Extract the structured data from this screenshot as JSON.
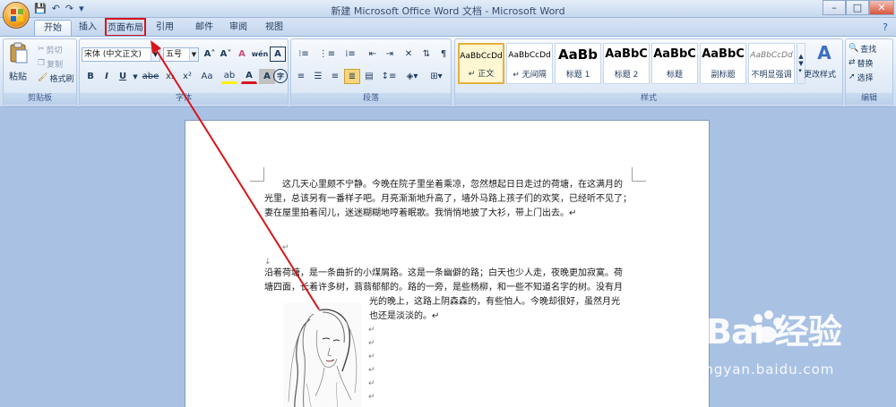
{
  "window": {
    "title": "新建 Microsoft Office Word 文档 - Microsoft Word",
    "controls": {
      "minimize": "–",
      "maximize": "□",
      "close": "✕"
    }
  },
  "qat": {
    "save": "💾",
    "undo": "↶",
    "redo": "↷",
    "more": "▾"
  },
  "tabs": [
    "开始",
    "插入",
    "页面布局",
    "引用",
    "邮件",
    "审阅",
    "视图"
  ],
  "highlighted_tab": "页面布局",
  "ribbon": {
    "clipboard": {
      "label": "剪贴板",
      "paste": "粘贴",
      "cut": "剪切",
      "copy": "复制",
      "format_painter": "格式刷"
    },
    "font": {
      "label": "字体",
      "font_name": "宋体 (中文正文)",
      "font_size": "五号",
      "bold": "B",
      "italic": "I",
      "underline": "U",
      "strike": "abe",
      "sub": "x₂",
      "sup": "x²",
      "case": "Aa",
      "grow": "A˄",
      "shrink": "A˅",
      "clear": "A",
      "phonetic": "wén",
      "border_char": "A",
      "highlight": "ab",
      "font_color": "A",
      "shading_char": "A",
      "enclose": "字"
    },
    "paragraph": {
      "label": "段落"
    },
    "styles": {
      "label": "样式",
      "items": [
        {
          "preview": "AaBbCcDd",
          "name": "↵ 正文"
        },
        {
          "preview": "AaBbCcDd",
          "name": "↵ 无间隔"
        },
        {
          "preview": "AaBb",
          "name": "标题 1"
        },
        {
          "preview": "AaBbC",
          "name": "标题 2"
        },
        {
          "preview": "AaBbC",
          "name": "标题"
        },
        {
          "preview": "AaBbC",
          "name": "副标题"
        },
        {
          "preview": "AaBbCcDd",
          "name": "不明显强调"
        }
      ],
      "change_styles": "更改样式"
    },
    "editing": {
      "label": "编辑",
      "find": "查找",
      "replace": "替换",
      "select": "选择"
    }
  },
  "document": {
    "para1": [
      "　　这几天心里颇不宁静。今晚在院子里坐着乘凉，忽然想起日日走过的荷塘，在这满月的",
      "光里，总该另有一番样子吧。月亮渐渐地升高了，墙外马路上孩子们的欢笑，已经听不见了；",
      "妻在屋里拍着闰儿，迷迷糊糊地哼着眠歌。我悄悄地披了大衫，带上门出去。↵"
    ],
    "blank_marks": [
      "↵",
      "↓"
    ],
    "para2_full": [
      "沿着荷塘，是一条曲折的小煤屑路。这是一条幽僻的路；白天也少人走，夜晚更加寂寞。荷",
      "塘四面，长着许多树，蓊蓊郁郁的。路的一旁，是些杨柳，和一些不知道名字的树。没有月"
    ],
    "para2_wrap": [
      "光的晚上，这路上阴森森的，有些怕人。今晚却很好，虽然月光",
      "也还是淡淡的。↵"
    ],
    "wrap_marks": [
      "↵",
      "↵",
      "↵",
      "↵",
      "↵",
      "↵"
    ]
  },
  "watermark": {
    "brand": "Bai  经验",
    "url": "jingyan.baidu.com"
  },
  "colors": {
    "annotation_red": "#d8151b",
    "ribbon_blue": "#c4d6ee",
    "doc_bg": "#a9c2e4"
  }
}
